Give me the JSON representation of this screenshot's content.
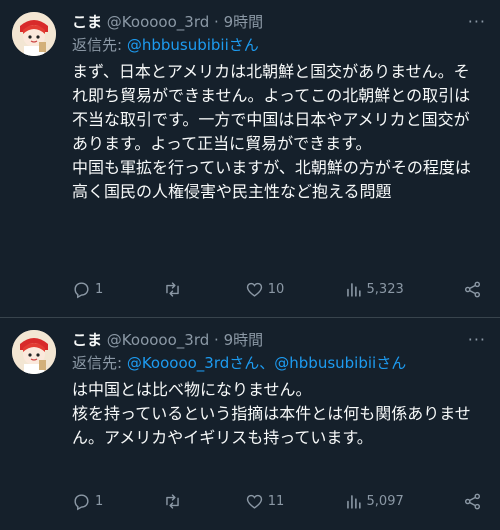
{
  "tweets": [
    {
      "name": "こま",
      "handle": "@Kooooo_3rd",
      "dot": "·",
      "time": "9時間",
      "reply_prefix": "返信先: ",
      "reply_to": "@hbbusubibiiさん",
      "text": "まず、日本とアメリカは北朝鮮と国交がありません。それ即ち貿易ができません。よってこの北朝鮮との取引は不当な取引です。一方で中国は日本やアメリカと国交があります。よって正当に貿易ができます。\n中国も軍拡を行っていますが、北朝鮮の方がその程度は高く国民の人権侵害や民主性など抱える問題",
      "reply_count": "1",
      "retweet_count": "",
      "like_count": "10",
      "view_count": "5,323"
    },
    {
      "name": "こま",
      "handle": "@Kooooo_3rd",
      "dot": "·",
      "time": "9時間",
      "reply_prefix": "返信先: ",
      "reply_to": "@Kooooo_3rdさん、@hbbusubibiiさん",
      "text": "は中国とは比べ物になりません。\n核を持っているという指摘は本件とは何も関係ありません。アメリカやイギリスも持っています。",
      "reply_count": "1",
      "retweet_count": "",
      "like_count": "11",
      "view_count": "5,097"
    }
  ],
  "icons": {
    "more": "more-horizontal-icon",
    "reply": "reply-icon",
    "retweet": "retweet-icon",
    "like": "heart-icon",
    "views": "views-chart-icon",
    "share": "share-icon"
  },
  "colors": {
    "background": "#15202b",
    "text": "#f7f9f9",
    "muted": "#8b98a5",
    "link": "#1d9bf0",
    "divider": "#38444d"
  }
}
